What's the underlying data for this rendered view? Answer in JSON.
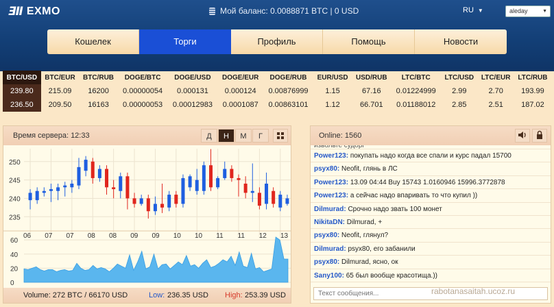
{
  "header": {
    "logo_mark": "ƎⅡ",
    "logo_text": "EXMO",
    "balance": "Мой баланс: 0.0088871 BTC | 0 USD",
    "lang": "RU",
    "username": "aleday"
  },
  "nav": {
    "tabs": [
      "Кошелек",
      "Торги",
      "Профиль",
      "Помощь",
      "Новости"
    ],
    "active": 1
  },
  "ticker": {
    "pairs": [
      "BTC/USD",
      "BTC/EUR",
      "BTC/RUB",
      "DOGE/BTC",
      "DOGE/USD",
      "DOGE/EUR",
      "DOGE/RUB",
      "EUR/USD",
      "USD/RUB",
      "LTC/BTC",
      "LTC/USD",
      "LTC/EUR",
      "LTC/RUB"
    ],
    "buy": [
      "239.80",
      "215.09",
      "16200",
      "0.00000054",
      "0.000131",
      "0.000124",
      "0.00876999",
      "1.15",
      "67.16",
      "0.01224999",
      "2.99",
      "2.70",
      "193.99"
    ],
    "sell": [
      "236.50",
      "209.50",
      "16163",
      "0.00000053",
      "0.00012983",
      "0.0001087",
      "0.00863101",
      "1.12",
      "66.701",
      "0.01188012",
      "2.85",
      "2.51",
      "187.02"
    ],
    "selected": 0
  },
  "chart_panel": {
    "server_time": "Время сервера: 12:33",
    "periods": [
      "Д",
      "Н",
      "М",
      "Г"
    ],
    "active_period": 1,
    "volume": "Volume: 272 BTC / 66170 USD",
    "low_label": "Low:",
    "low_value": "236.35 USD",
    "high_label": "High:",
    "high_value": "253.39 USD"
  },
  "chat": {
    "online": "Online: 1560",
    "input_placeholder": "Текст сообщения...",
    "cut_text": "извольте судорг",
    "messages": [
      {
        "user": "Power123:",
        "text": "покупать надо когда все спали и курс падал 15700"
      },
      {
        "user": "psyx80:",
        "text": "Neofit, глянь в ЛС"
      },
      {
        "user": "Power123:",
        "text": "13.09 04:44 Buy 15743 1.0160946 15996.3772878"
      },
      {
        "user": "Power123:",
        "text": "а сейчас надо впаривать то что купил ))"
      },
      {
        "user": "Dilmurad:",
        "text": "Срочно надо звать 100 монет"
      },
      {
        "user": "NikitaDN:",
        "text": "Dilmurad, +"
      },
      {
        "user": "psyx80:",
        "text": "Neofit, глянул?"
      },
      {
        "user": "Dilmurad:",
        "text": "psyx80, его забанили"
      },
      {
        "user": "psyx80:",
        "text": "Dilmurad, ясно, ок"
      },
      {
        "user": "Sany100:",
        "text": "65 был вообще красотища.))"
      }
    ]
  },
  "watermark": "rabotanasaitah.ucoz.ru",
  "colors": {
    "up": "#1f5fe0",
    "down": "#e0261e",
    "accent": "#1a4fd6",
    "volume": "#5ab6ee"
  },
  "chart_data": [
    {
      "type": "candlestick",
      "x_labels": [
        "06",
        "07",
        "07",
        "08",
        "08",
        "09",
        "09",
        "10",
        "10",
        "11",
        "11",
        "12",
        "13"
      ],
      "y_ticks": [
        235,
        240,
        245,
        250
      ],
      "ylim": [
        233,
        253.5
      ],
      "grid": true,
      "candles": [
        {
          "o": 239.5,
          "c": 241.5,
          "h": 242.5,
          "l": 237
        },
        {
          "o": 239.5,
          "c": 242,
          "h": 243,
          "l": 238.5
        },
        {
          "o": 241.5,
          "c": 242,
          "h": 243,
          "l": 240.5
        },
        {
          "o": 242,
          "c": 242.5,
          "h": 244,
          "l": 239
        },
        {
          "o": 242,
          "c": 243,
          "h": 244,
          "l": 239.5
        },
        {
          "o": 243,
          "c": 243.5,
          "h": 244.5,
          "l": 240.5
        },
        {
          "o": 243,
          "c": 244,
          "h": 245,
          "l": 241.5
        },
        {
          "o": 243.5,
          "c": 248.5,
          "h": 251,
          "l": 242.5
        },
        {
          "o": 247.5,
          "c": 250.5,
          "h": 251.5,
          "l": 246
        },
        {
          "o": 250,
          "c": 245.5,
          "h": 251,
          "l": 244
        },
        {
          "o": 245.5,
          "c": 248,
          "h": 249,
          "l": 244.5
        },
        {
          "o": 248,
          "c": 243,
          "h": 249,
          "l": 241
        },
        {
          "o": 243,
          "c": 242.5,
          "h": 245,
          "l": 240
        },
        {
          "o": 242,
          "c": 246,
          "h": 247,
          "l": 240
        },
        {
          "o": 246,
          "c": 240,
          "h": 247,
          "l": 237
        },
        {
          "o": 240,
          "c": 238.5,
          "h": 241.5,
          "l": 237.5
        },
        {
          "o": 238.5,
          "c": 240,
          "h": 241,
          "l": 238
        },
        {
          "o": 240,
          "c": 236.5,
          "h": 241,
          "l": 234.5
        },
        {
          "o": 236.5,
          "c": 238.5,
          "h": 240.5,
          "l": 235.5
        },
        {
          "o": 238.5,
          "c": 237.5,
          "h": 244,
          "l": 236
        },
        {
          "o": 237.5,
          "c": 241,
          "h": 242,
          "l": 236.5
        },
        {
          "o": 241,
          "c": 238.5,
          "h": 242,
          "l": 237.5
        },
        {
          "o": 238.5,
          "c": 245.5,
          "h": 246.5,
          "l": 237.5
        },
        {
          "o": 243,
          "c": 246,
          "h": 246.5,
          "l": 242
        },
        {
          "o": 242,
          "c": 245,
          "h": 248,
          "l": 241
        },
        {
          "o": 242,
          "c": 249,
          "h": 250,
          "l": 241
        },
        {
          "o": 249,
          "c": 243,
          "h": 253.4,
          "l": 242
        },
        {
          "o": 243,
          "c": 245.5,
          "h": 246,
          "l": 242.5
        },
        {
          "o": 245.5,
          "c": 248,
          "h": 250,
          "l": 245
        },
        {
          "o": 248,
          "c": 245.5,
          "h": 249,
          "l": 244.5
        },
        {
          "o": 245.5,
          "c": 245,
          "h": 246.5,
          "l": 240.5
        },
        {
          "o": 244,
          "c": 241.5,
          "h": 246,
          "l": 240
        },
        {
          "o": 241.5,
          "c": 242,
          "h": 249.5,
          "l": 239
        },
        {
          "o": 241.5,
          "c": 238,
          "h": 243,
          "l": 237
        },
        {
          "o": 238.5,
          "c": 244,
          "h": 247,
          "l": 237
        },
        {
          "o": 242,
          "c": 238.5,
          "h": 243,
          "l": 237.5
        },
        {
          "o": 237.5,
          "c": 241,
          "h": 242,
          "l": 236.5
        },
        {
          "o": 238.5,
          "c": 240,
          "h": 241,
          "l": 238
        }
      ]
    },
    {
      "type": "area",
      "y_ticks": [
        0,
        20,
        40,
        60
      ],
      "ylim": [
        0,
        65
      ],
      "values": [
        19,
        18,
        20,
        22,
        18,
        16,
        18,
        18,
        15,
        17,
        18,
        16,
        17,
        27,
        20,
        17,
        18,
        24,
        19,
        21,
        19,
        15,
        20,
        26,
        23,
        20,
        39,
        17,
        29,
        44,
        19,
        22,
        40,
        19,
        25,
        26,
        19,
        24,
        29,
        25,
        38,
        23,
        25,
        20,
        27,
        32,
        21,
        23,
        27,
        32,
        29,
        37,
        24,
        43,
        23,
        21,
        41,
        19,
        21,
        15,
        17,
        19,
        64,
        60,
        33,
        33
      ]
    }
  ]
}
